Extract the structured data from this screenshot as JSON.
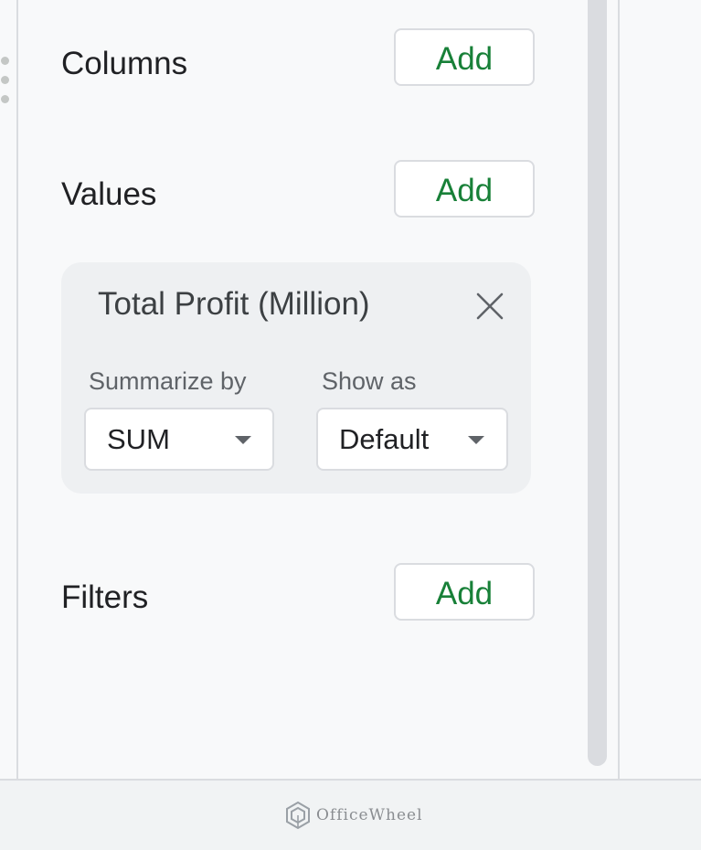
{
  "sections": {
    "columns": {
      "label": "Columns",
      "add_label": "Add"
    },
    "values": {
      "label": "Values",
      "add_label": "Add"
    },
    "filters": {
      "label": "Filters",
      "add_label": "Add"
    }
  },
  "value_card": {
    "title": "Total Profit (Million)",
    "summarize_by": {
      "label": "Summarize by",
      "selected": "SUM"
    },
    "show_as": {
      "label": "Show as",
      "selected": "Default"
    }
  },
  "footer": {
    "logo_text": "OfficeWheel"
  },
  "colors": {
    "accent_green": "#188038",
    "panel_bg": "#f8f9fa",
    "card_bg": "#eef0f2",
    "border": "#dadce0"
  },
  "icons": {
    "close": "close-icon",
    "dropdown": "chevron-down-icon",
    "drag": "drag-handle-icon",
    "logo": "officewheel-logo-icon"
  }
}
